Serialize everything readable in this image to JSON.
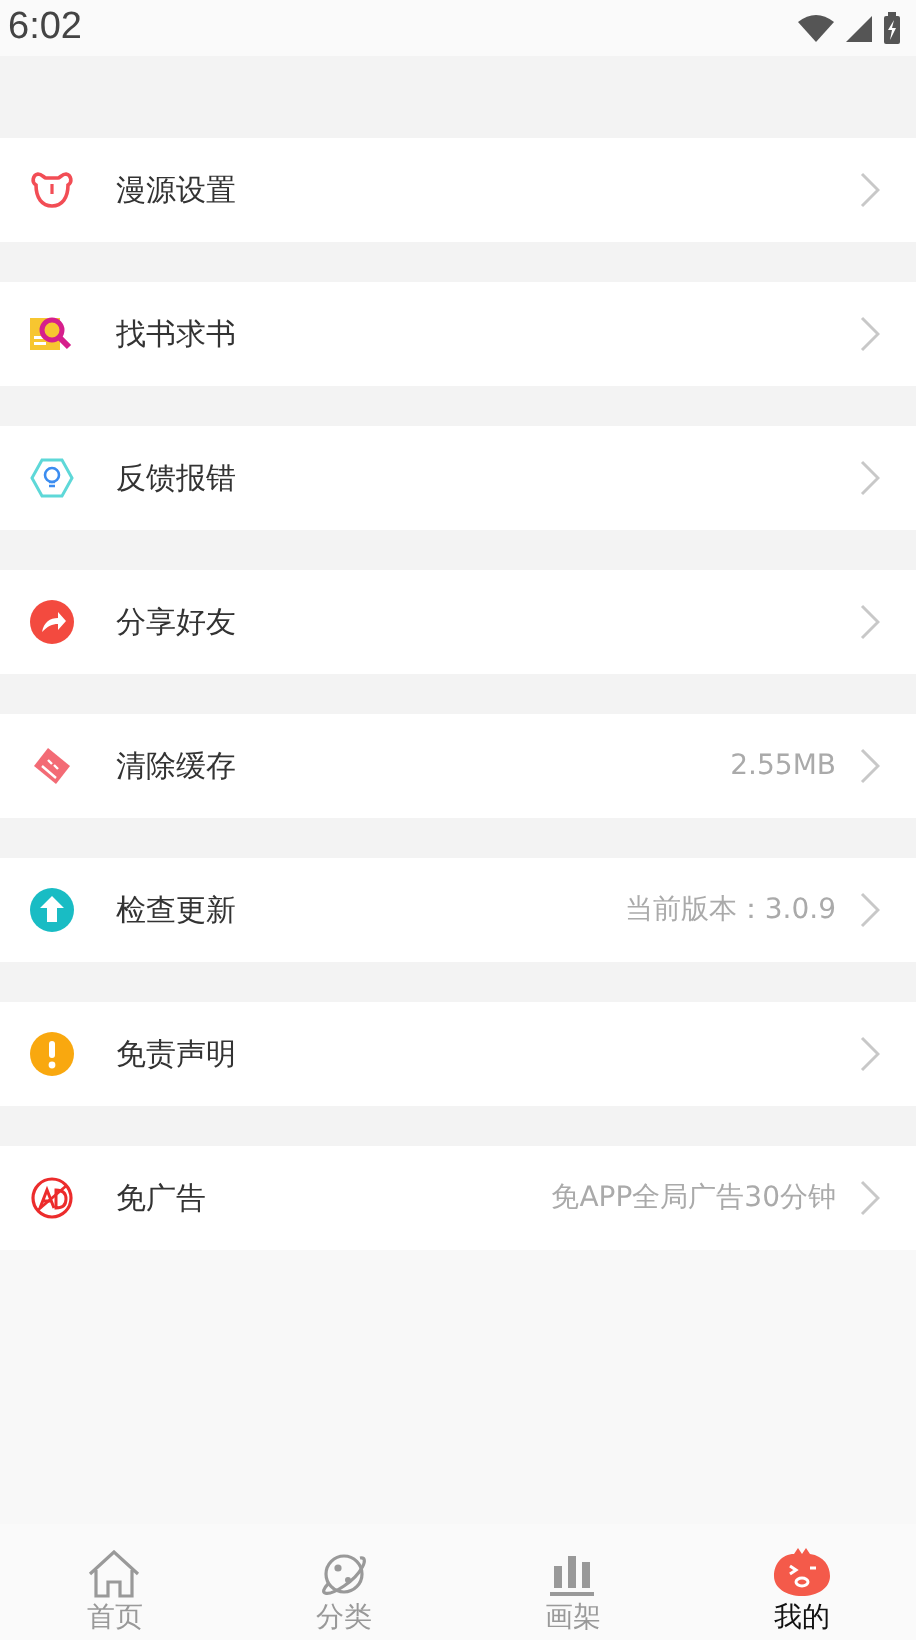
{
  "status_bar": {
    "time": "6:02"
  },
  "menu": [
    {
      "label": "漫源设置"
    },
    {
      "label": "找书求书"
    },
    {
      "label": "反馈报错"
    },
    {
      "label": "分享好友"
    },
    {
      "label": "清除缓存",
      "value": "2.55MB"
    },
    {
      "label": "检查更新",
      "value": "当前版本：3.0.9"
    },
    {
      "label": "免责声明"
    },
    {
      "label": "免广告",
      "value": "免APP全局广告30分钟"
    }
  ],
  "tab_bar": [
    {
      "label": "首页",
      "selected": false
    },
    {
      "label": "分类",
      "selected": false
    },
    {
      "label": "画架",
      "selected": false
    },
    {
      "label": "我的",
      "selected": true
    }
  ]
}
